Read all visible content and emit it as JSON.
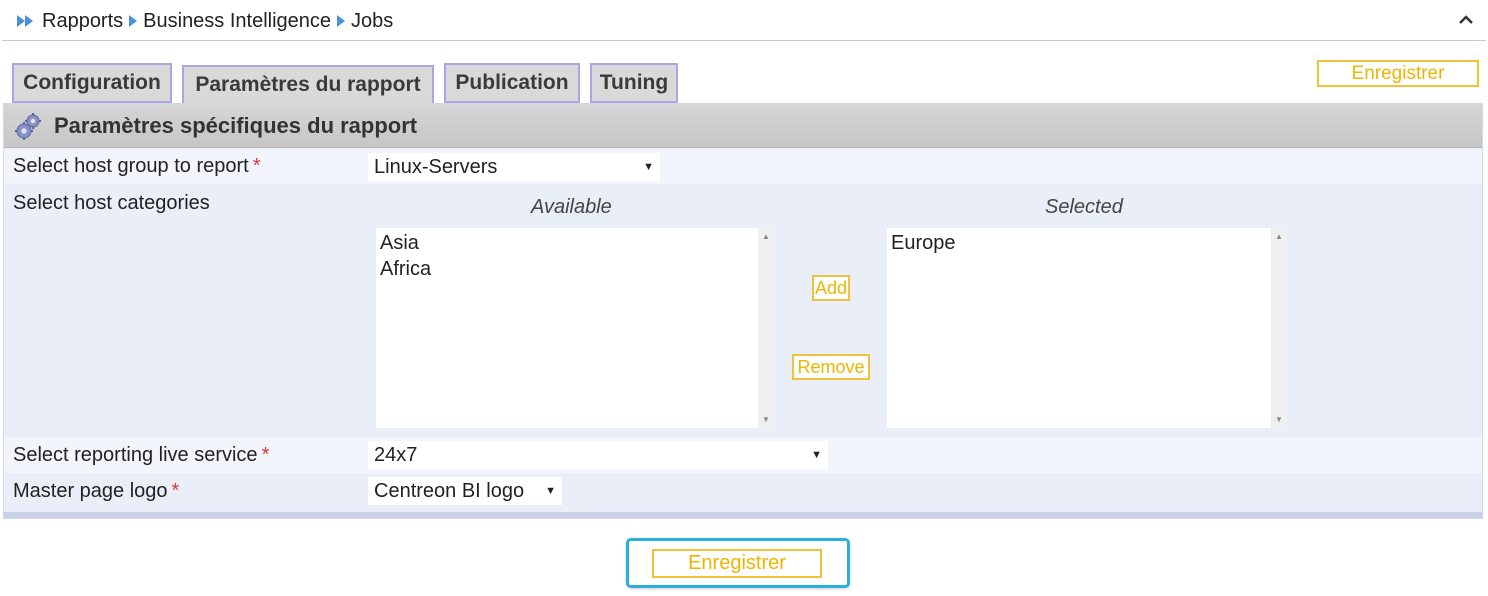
{
  "breadcrumb": {
    "items": [
      "Rapports",
      "Business Intelligence",
      "Jobs"
    ]
  },
  "tabs": [
    {
      "label": "Configuration"
    },
    {
      "label": "Paramètres du rapport"
    },
    {
      "label": "Publication"
    },
    {
      "label": "Tuning"
    }
  ],
  "active_tab": "Paramètres du rapport",
  "top_save_label": "Enregistrer",
  "panel": {
    "title": "Paramètres spécifiques du rapport",
    "host_group": {
      "label": "Select host group to report",
      "required": "*",
      "value": "Linux-Servers"
    },
    "host_categories": {
      "label": "Select host categories",
      "available_header": "Available",
      "selected_header": "Selected",
      "available": [
        "Asia",
        "Africa"
      ],
      "selected": [
        "Europe"
      ],
      "add_label": "Add",
      "remove_label": "Remove"
    },
    "live_service": {
      "label": "Select reporting live service",
      "required": "*",
      "value": "24x7"
    },
    "master_logo": {
      "label": "Master page logo",
      "required": "*",
      "value": "Centreon BI logo"
    }
  },
  "bottom_save_label": "Enregistrer",
  "colors": {
    "accent_yellow": "#f0b400",
    "tab_border": "#a9a7e6",
    "highlight_blue": "#2bb0de",
    "breadcrumb_arrow": "#4a8fe0"
  }
}
